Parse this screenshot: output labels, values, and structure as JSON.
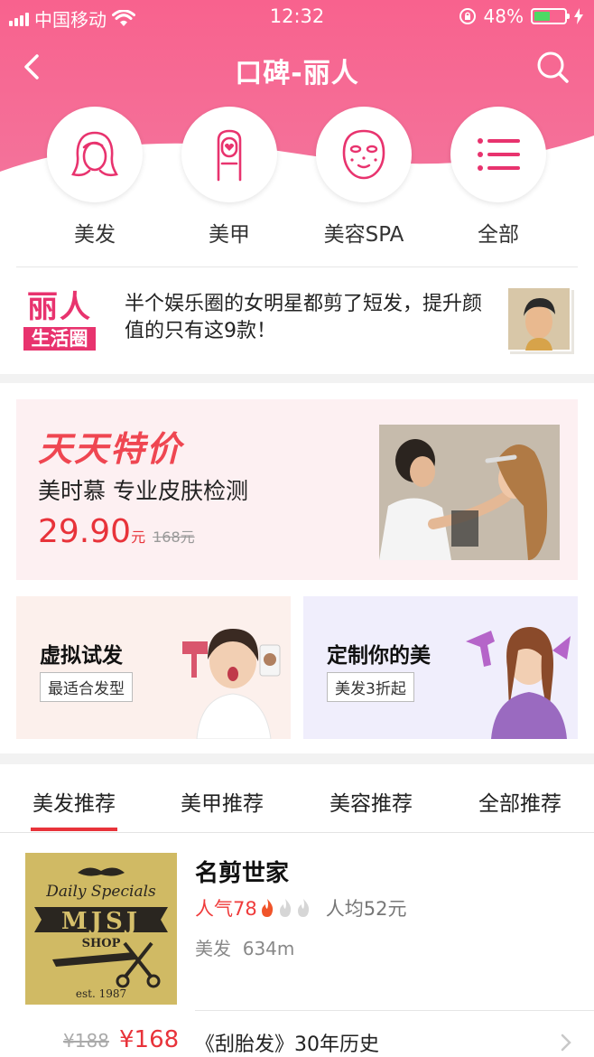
{
  "status_bar": {
    "carrier": "中国移动",
    "time": "12:32",
    "battery": "48%",
    "battery_level": 0.48
  },
  "nav": {
    "title": "口碑-丽人",
    "back_icon": "chevron-left-icon",
    "search_icon": "search-icon"
  },
  "colors": {
    "brand_pink": "#f75f8c",
    "accent_red": "#e8333a",
    "icon_pink": "#e8336e"
  },
  "categories": [
    {
      "label": "美发",
      "icon": "hair-icon"
    },
    {
      "label": "美甲",
      "icon": "nail-icon"
    },
    {
      "label": "美容SPA",
      "icon": "face-mask-icon"
    },
    {
      "label": "全部",
      "icon": "list-icon"
    }
  ],
  "news": {
    "logo_line1": "丽人",
    "logo_line2": "生活圈",
    "text": "半个娱乐圈的女明星都剪了短发，提升颜值的只有这9款！"
  },
  "promo": {
    "title": "天天特价",
    "subtitle": "美时慕 专业皮肤检测",
    "price": "29.90",
    "price_unit": "元",
    "old_price": "168元"
  },
  "cards": [
    {
      "title": "虚拟试发",
      "tag": "最适合发型"
    },
    {
      "title": "定制你的美",
      "tag": "美发3折起"
    }
  ],
  "tabs": [
    {
      "label": "美发推荐",
      "active": true
    },
    {
      "label": "美甲推荐",
      "active": false
    },
    {
      "label": "美容推荐",
      "active": false
    },
    {
      "label": "全部推荐",
      "active": false
    }
  ],
  "shop": {
    "name": "名剪世家",
    "popularity": "人气78",
    "popularity_flames": 1,
    "popularity_flames_total": 3,
    "avg_price": "人均52元",
    "category": "美发",
    "distance": "634m",
    "logo_text": "MJSJ",
    "logo_top": "Daily Specials",
    "logo_shop": "SHOP",
    "logo_est": "est. 1987",
    "deal_old_price": "¥188",
    "deal_price": "¥168",
    "deal_desc": "《刮胎发》30年历史"
  }
}
